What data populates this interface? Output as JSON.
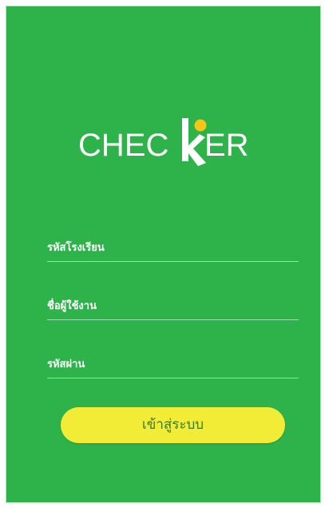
{
  "logo": {
    "text_left": "CHEC",
    "text_right": "ER"
  },
  "form": {
    "school_code_label": "รหัสโรงเรียน",
    "username_label": "ชื่อผู้ใช้งาน",
    "password_label": "รหัสผ่าน"
  },
  "login_button_label": "เข้าสู่ระบบ",
  "colors": {
    "background": "#2db34a",
    "button": "#f2ec37",
    "logo_accent": "#f5c518"
  }
}
